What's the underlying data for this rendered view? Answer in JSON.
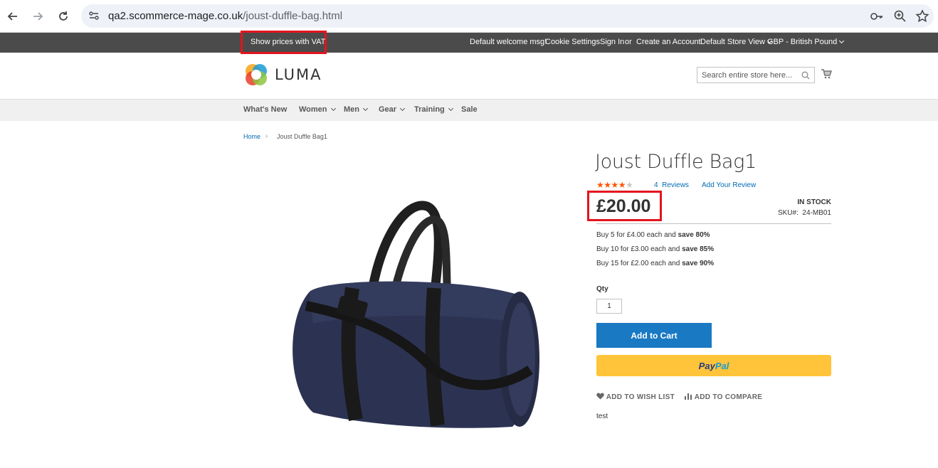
{
  "browser": {
    "url_host": "qa2.scommerce-mage.co.uk",
    "url_path": "/joust-duffle-bag.html"
  },
  "panel": {
    "vat_label": "Show prices with VAT",
    "welcome": "Default welcome msg!",
    "cookie": "Cookie Settings",
    "sign_in": "Sign In",
    "or": "or",
    "create_account": "Create an Account",
    "store_view": "Default Store View",
    "currency": "GBP - British Pound"
  },
  "header": {
    "logo_text": "LUMA",
    "search_placeholder": "Search entire store here..."
  },
  "nav": {
    "items": [
      {
        "label": "What's New"
      },
      {
        "label": "Women"
      },
      {
        "label": "Men"
      },
      {
        "label": "Gear"
      },
      {
        "label": "Training"
      },
      {
        "label": "Sale"
      }
    ]
  },
  "breadcrumb": {
    "home": "Home",
    "separator": "›",
    "current": "Joust Duffle Bag1"
  },
  "product": {
    "title": "Joust Duffle Bag1",
    "rating": 4,
    "rating_max": 5,
    "reviews_count": "4",
    "reviews_label": "Reviews",
    "add_review": "Add Your Review",
    "price": "£20.00",
    "stock": "IN STOCK",
    "sku_label": "SKU#:",
    "sku": "24-MB01",
    "tiers": [
      {
        "text": "Buy 5 for £4.00 each and ",
        "save": "save 80%"
      },
      {
        "text": "Buy 10 for £3.00 each and ",
        "save": "save 85%"
      },
      {
        "text": "Buy 15 for £2.00 each and ",
        "save": "save 90%"
      }
    ],
    "qty_label": "Qty",
    "qty_value": "1",
    "add_to_cart": "Add to Cart",
    "paypal_a": "Pay",
    "paypal_b": "Pal",
    "wishlist": "ADD TO WISH LIST",
    "compare": "ADD TO COMPARE",
    "description": "test"
  },
  "colors": {
    "accent": "#1979c3",
    "highlight": "#e3141e",
    "panel_bg": "#4b4b4b",
    "paypal": "#ffc439",
    "star": "#ff5501"
  }
}
